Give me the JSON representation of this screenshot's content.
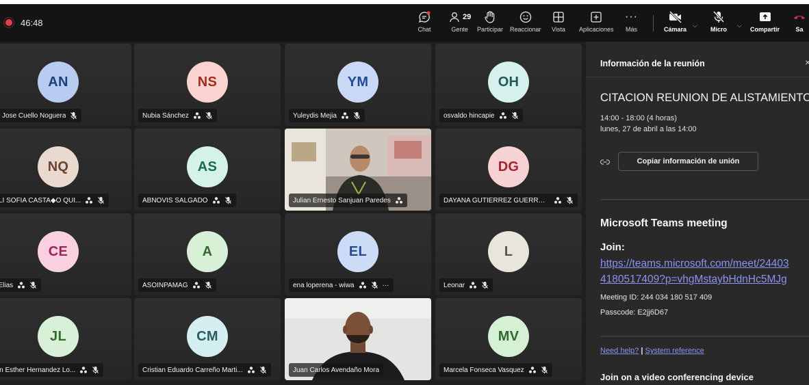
{
  "topbar": {
    "timer": "46:48",
    "participants_count": "29",
    "buttons": {
      "chat": "Chat",
      "people": "Gente",
      "raise": "Participar",
      "react": "Reaccionar",
      "view": "Vista",
      "apps": "Aplicaciones",
      "more": "Más",
      "camera": "Cámara",
      "mic": "Micro",
      "share": "Compartir",
      "leave": "Sa"
    },
    "colors": {
      "recording": "#e0404a",
      "chat_badge": "#e0404a",
      "leave": "#c4314b"
    }
  },
  "tiles": [
    {
      "initials": "AN",
      "name": "ando Jose Cuello Noguera",
      "bg": "#b7ccf0",
      "fg": "#1a3f7a"
    },
    {
      "initials": "NS",
      "name": "Nubia Sánchez",
      "bg": "#f8d3cf",
      "fg": "#a32a1d"
    },
    {
      "initials": "YM",
      "name": "Yuleydis Mejia",
      "bg": "#c8d8f5",
      "fg": "#1f4c91"
    },
    {
      "initials": "OH",
      "name": "osvaldo hincapie",
      "bg": "#d6f0ee",
      "fg": "#1f5a56"
    },
    {
      "initials": "NQ",
      "name": "THALI SOFIA CASTA◆O QUI...",
      "bg": "#ead9cf",
      "fg": "#6c4430"
    },
    {
      "initials": "AS",
      "name": "ABNOVIS SALGADO",
      "bg": "#d4f2e8",
      "fg": "#1b6a52"
    },
    {
      "initials": "",
      "name": "Julian Ernesto Sanjuan Paredes",
      "video": true
    },
    {
      "initials": "DG",
      "name": "DAYANA GUTIERREZ GUERRERO",
      "bg": "#f7d2d4",
      "fg": "#a1252f"
    },
    {
      "initials": "CE",
      "name": "npo Elias",
      "bg": "#f9d0e0",
      "fg": "#a0245a"
    },
    {
      "initials": "A",
      "name": "ASOINPAMAG",
      "bg": "#d8f0d7",
      "fg": "#2f6b2c"
    },
    {
      "initials": "EL",
      "name": "ena loperena - wiwa",
      "bg": "#cddcf6",
      "fg": "#234d8f",
      "more": "···"
    },
    {
      "initials": "L",
      "name": "Leonar",
      "bg": "#e8e6dc",
      "fg": "#5a5647"
    },
    {
      "initials": "JL",
      "name": "quelin Esther Hernandez Lo...",
      "bg": "#d8f0d8",
      "fg": "#2f6b2c"
    },
    {
      "initials": "CM",
      "name": "Cristian Eduardo Carreño Marti...",
      "bg": "#d5eff0",
      "fg": "#265c62"
    },
    {
      "initials": "",
      "name": "Juan Carlos Avendaño Mora",
      "video": true
    },
    {
      "initials": "MV",
      "name": "Marcela Fonseca Vasquez",
      "bg": "#d6f0d6",
      "fg": "#2d6a2b"
    }
  ],
  "panel": {
    "heading": "Información de la reunión",
    "close": "×",
    "meeting_title": "CITACION REUNION DE ALISTAMIENTO",
    "time": "14:00 - 18:00 (4 horas)",
    "date": "lunes, 27 de abril a las 14:00",
    "copy_button": "Copiar información de unión",
    "section_title": "Microsoft Teams meeting",
    "join_label": "Join:",
    "join_url_line1": "https://teams.microsoft.com/meet/24403",
    "join_url_line2": "4180517409?p=vhgMstaybHdnHc5MJg",
    "meeting_id": "Meeting ID: 244 034 180 517 409",
    "passcode": "Passcode: E2jj6D67",
    "help_link": "Need help?",
    "help_sep": " | ",
    "system_link": "System reference",
    "vc_title": "Join on a video conferencing device"
  }
}
